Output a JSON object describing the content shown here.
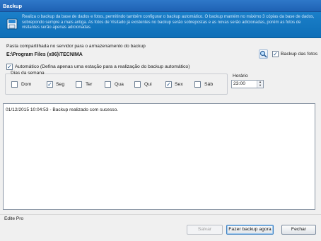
{
  "window": {
    "title": "Backup"
  },
  "banner": {
    "text": "Realiza o backup da base de dados e fotos, permitindo também configurar o backup automático. O backup mantém no máximo 3 cópias da base de dados, sobrepondo sempre a mais antiga. As fotos de Visitado já existentes no backup serão sobrepostas e as novas serão adicionadas, porém as fotos de visitantes serão apenas adicionadas.",
    "icon": "save-disk-icon"
  },
  "backup_path": {
    "label": "Pasta compartilhada no servidor para o armazenamento do backup",
    "value": "E:\\Program Files (x86)\\TECNIMA",
    "search_icon": "magnifier-icon"
  },
  "backup_fotos": {
    "label": "Backup das fotos",
    "checked": true
  },
  "automatic": {
    "label": "Automático (Defina apenas uma estação para a realização do backup automático)",
    "checked": true
  },
  "days": {
    "label": "Dias da semana",
    "items": [
      {
        "label": "Dom",
        "checked": false
      },
      {
        "label": "Seg",
        "checked": true
      },
      {
        "label": "Ter",
        "checked": false
      },
      {
        "label": "Qua",
        "checked": false
      },
      {
        "label": "Qui",
        "checked": false
      },
      {
        "label": "Sex",
        "checked": true
      },
      {
        "label": "Sáb",
        "checked": false
      }
    ]
  },
  "time": {
    "label": "Horário",
    "value": "23:00"
  },
  "log": {
    "lines": [
      "01/12/2015 10:04:53 - Backup realizado com sucesso."
    ]
  },
  "status": {
    "text": "Edite Pro"
  },
  "buttons": {
    "save": "Salvar",
    "backup_now": "Fazer backup agora",
    "close": "Fechar"
  },
  "colors": {
    "banner": "#1b7fc9",
    "titlebar": "#2f78c9",
    "log_bg": "#ffffff"
  }
}
